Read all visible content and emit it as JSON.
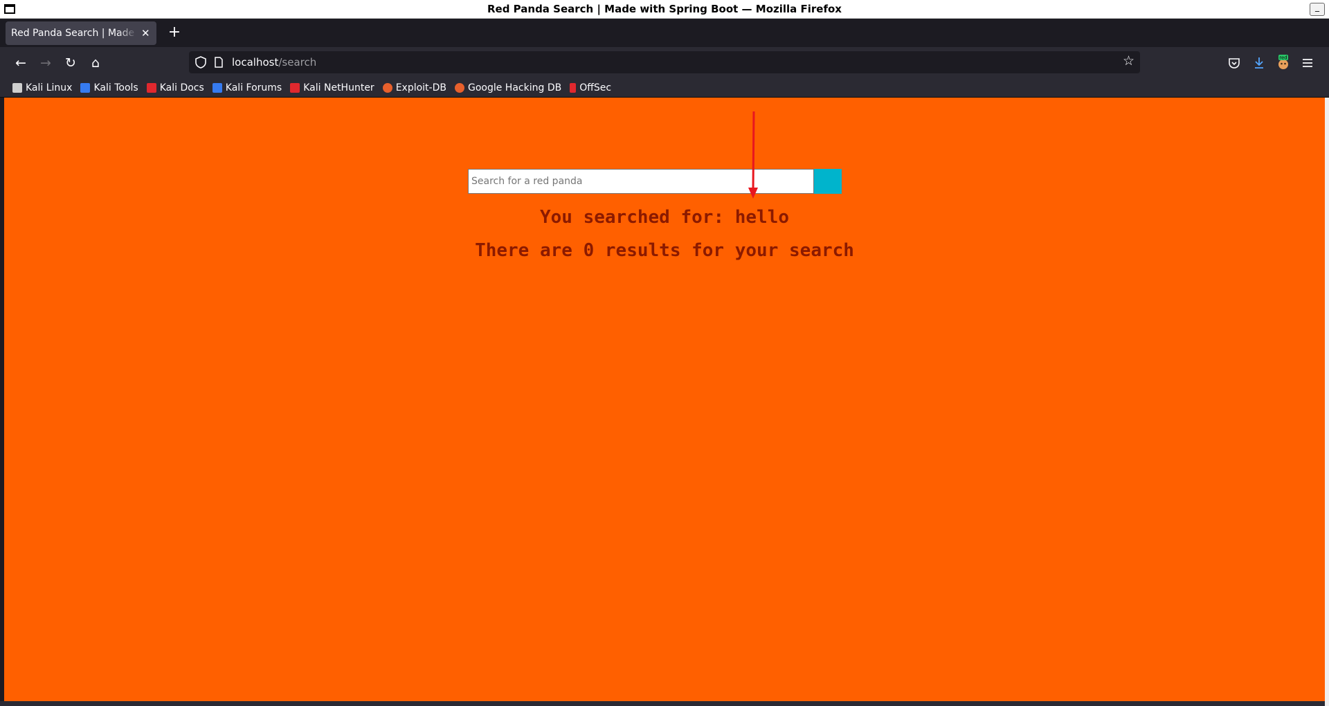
{
  "window": {
    "title": "Red Panda Search | Made with Spring Boot — Mozilla Firefox",
    "minimize_label": "_"
  },
  "tabs": [
    {
      "title": "Red Panda Search | Made with Spring Boot",
      "close_glyph": "✕"
    }
  ],
  "new_tab_glyph": "+",
  "navbar": {
    "back_glyph": "←",
    "forward_glyph": "→",
    "reload_glyph": "↻",
    "home_glyph": "⌂",
    "url_host": "localhost",
    "url_path": "/search",
    "bookmark_glyph": "☆",
    "icons": [
      "shield-icon",
      "page-icon",
      "pocket-icon",
      "download-icon",
      "extension-icon",
      "menu-icon"
    ],
    "extension_badge": "red"
  },
  "bookmarks": [
    {
      "label": "Kali Linux",
      "icon": "kali-dragon-icon",
      "color": "#cfcfcf"
    },
    {
      "label": "Kali Tools",
      "icon": "kali-tools-icon",
      "color": "#367bf0"
    },
    {
      "label": "Kali Docs",
      "icon": "kali-docs-icon",
      "color": "#e0282e"
    },
    {
      "label": "Kali Forums",
      "icon": "kali-forums-icon",
      "color": "#367bf0"
    },
    {
      "label": "Kali NetHunter",
      "icon": "nethunter-icon",
      "color": "#e0282e"
    },
    {
      "label": "Exploit-DB",
      "icon": "exploitdb-icon",
      "color": "#e8602c"
    },
    {
      "label": "Google Hacking DB",
      "icon": "ghdb-icon",
      "color": "#e8602c"
    },
    {
      "label": "OffSec",
      "icon": "offsec-icon",
      "color": "#e0282e"
    }
  ],
  "page": {
    "background": "#ff6000",
    "search": {
      "placeholder": "Search for a red panda",
      "button_color": "#00b4cc"
    },
    "searched_for": "You searched for: hello",
    "results_text": "There are 0 results for your search",
    "text_color": "#8b1a00"
  }
}
